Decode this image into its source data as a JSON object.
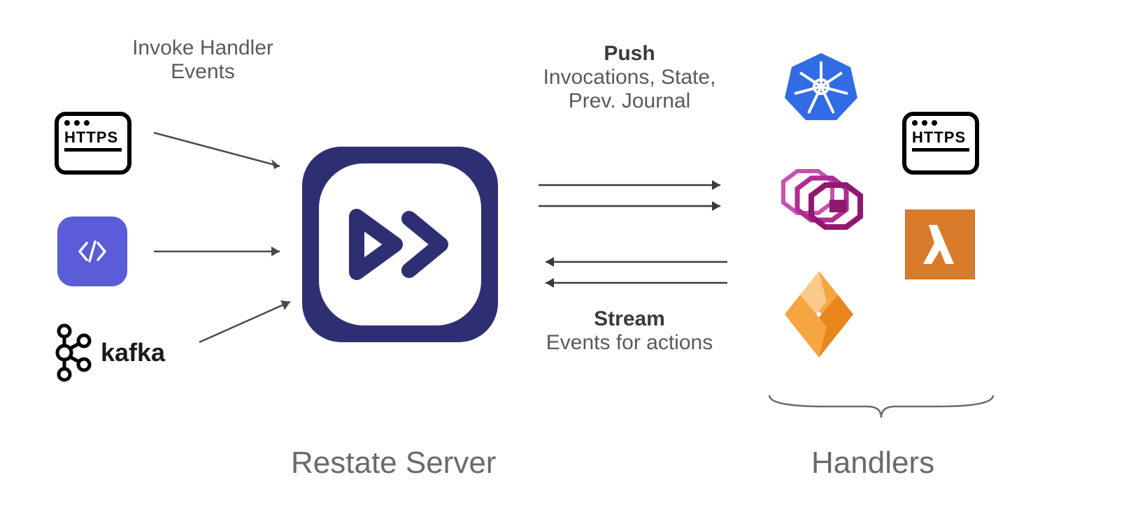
{
  "left_header": {
    "line1": "Invoke Handler",
    "line2": "Events"
  },
  "push_section": {
    "title": "Push",
    "line1": "Invocations, State,",
    "line2": "Prev. Journal"
  },
  "stream_section": {
    "title": "Stream",
    "line1": "Events for actions"
  },
  "https_label": "HTTPS",
  "kafka_label": "kafka",
  "restate_label": "Restate Server",
  "handlers_label": "Handlers",
  "icons": {
    "https": "https-icon",
    "code": "code-icon",
    "kafka": "kafka-icon",
    "restate": "restate-icon",
    "kubernetes": "kubernetes-icon",
    "hexagon": "hexagon-stack-icon",
    "cloudflare": "cloudflare-icon",
    "lambda": "lambda-icon"
  },
  "colors": {
    "text_gray": "#5a5a5a",
    "text_dark": "#3a3a3a",
    "restate_bg": "#2e2f72",
    "code_bg": "#5a5cd9",
    "kubernetes": "#326ce5",
    "hexagon": "#b02c92",
    "cloudflare_orange": "#f38020",
    "lambda_bg": "#d87b2b"
  }
}
